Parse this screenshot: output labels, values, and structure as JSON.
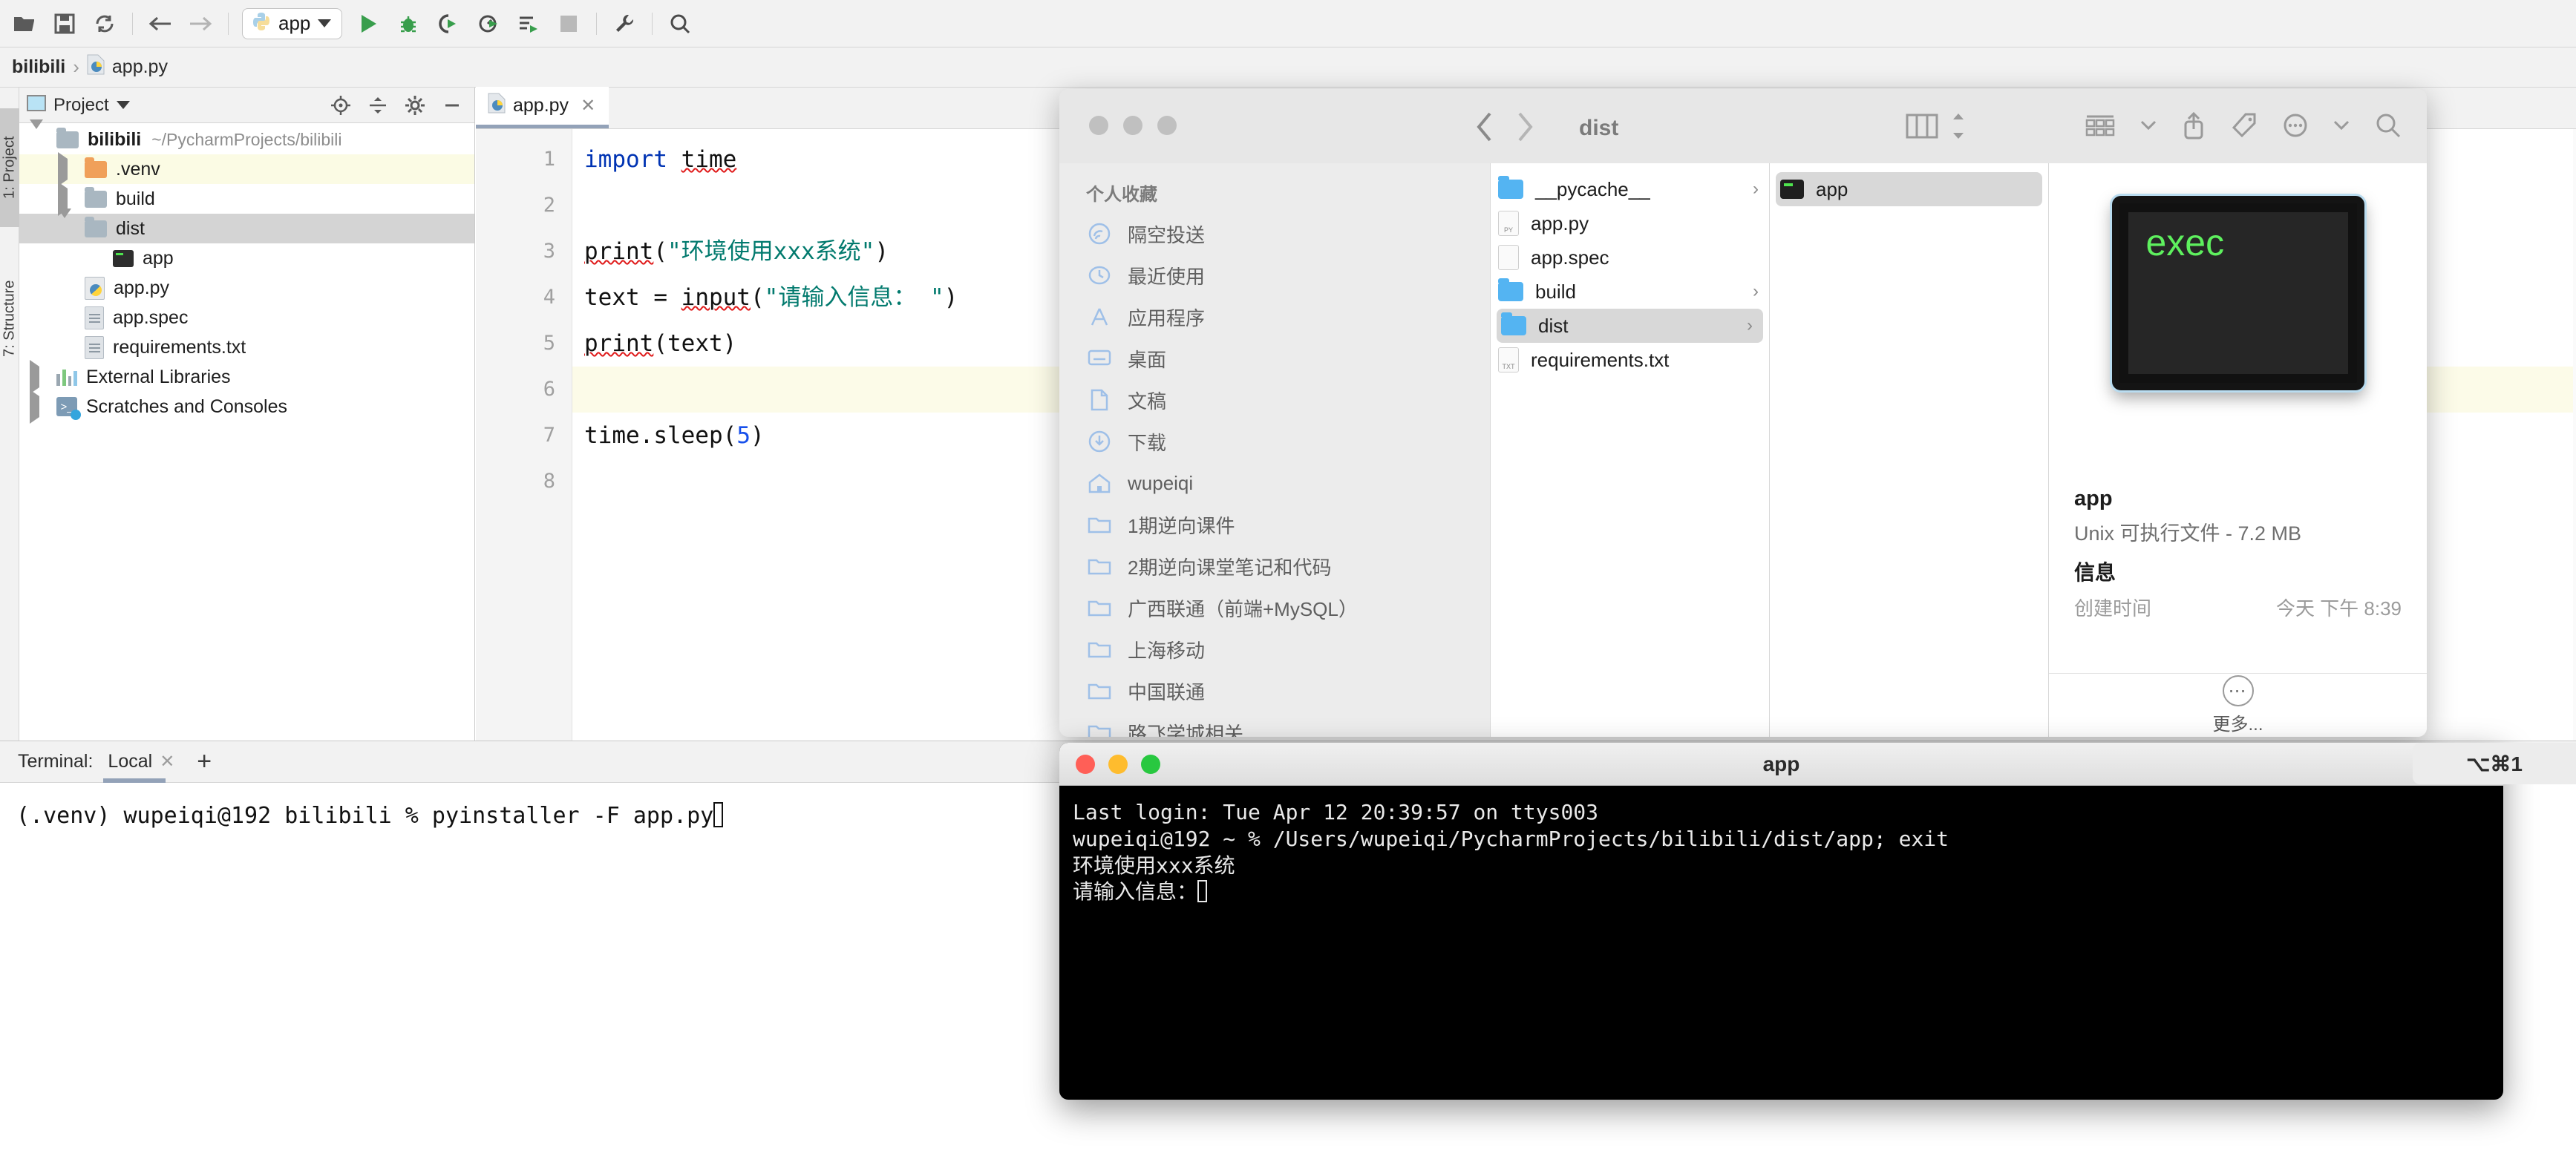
{
  "ide": {
    "toolbar": {
      "icons": [
        "open-folder-icon",
        "save-icon",
        "sync-icon",
        "back-arrow-icon",
        "forward-arrow-icon"
      ],
      "run_config": "app",
      "run_icons": [
        "run-icon",
        "debug-icon",
        "run-coverage-icon",
        "profile-icon",
        "run-with-icon",
        "stop-icon",
        "wrench-icon",
        "search-icon"
      ]
    },
    "breadcrumb": {
      "root": "bilibili",
      "sep": "›",
      "file": "app.py"
    },
    "left_tabs": [
      {
        "label": "1: Project"
      },
      {
        "label": "7: Structure"
      }
    ],
    "project_panel": {
      "title": "Project",
      "tree": [
        {
          "label": "bilibili",
          "path": "~/PycharmProjects/bilibili",
          "icon": "folder-icon",
          "twisty": "down",
          "bold": true,
          "indent": 0,
          "state": "none"
        },
        {
          "label": ".venv",
          "path": "",
          "icon": "folder-orange-icon",
          "twisty": "right",
          "bold": false,
          "indent": 1,
          "state": "yellow"
        },
        {
          "label": "build",
          "path": "",
          "icon": "folder-icon",
          "twisty": "right",
          "bold": false,
          "indent": 1,
          "state": "none"
        },
        {
          "label": "dist",
          "path": "",
          "icon": "folder-icon",
          "twisty": "down",
          "bold": false,
          "indent": 1,
          "state": "grey"
        },
        {
          "label": "app",
          "path": "",
          "icon": "exec-file-icon",
          "twisty": "none",
          "bold": false,
          "indent": 2,
          "state": "none"
        },
        {
          "label": "app.py",
          "path": "",
          "icon": "python-file-icon",
          "twisty": "none",
          "bold": false,
          "indent": 1,
          "state": "none"
        },
        {
          "label": "app.spec",
          "path": "",
          "icon": "text-file-icon",
          "twisty": "none",
          "bold": false,
          "indent": 1,
          "state": "none"
        },
        {
          "label": "requirements.txt",
          "path": "",
          "icon": "text-file-icon",
          "twisty": "none",
          "bold": false,
          "indent": 1,
          "state": "none"
        },
        {
          "label": "External Libraries",
          "path": "",
          "icon": "libraries-icon",
          "twisty": "right",
          "bold": false,
          "indent": 0,
          "state": "none"
        },
        {
          "label": "Scratches and Consoles",
          "path": "",
          "icon": "scratches-icon",
          "twisty": "right",
          "bold": false,
          "indent": 0,
          "state": "none"
        }
      ]
    },
    "editor": {
      "tab": {
        "label": "app.py",
        "close": "✕",
        "icon": "python-file-icon"
      },
      "line_numbers": [
        "1",
        "2",
        "3",
        "4",
        "5",
        "6",
        "7",
        "8"
      ],
      "lines": [
        {
          "n": "1",
          "segs": [
            {
              "t": "import",
              "c": "kw"
            },
            {
              "t": " ",
              "c": ""
            },
            {
              "t": "time",
              "c": "sq"
            }
          ],
          "hl": false
        },
        {
          "n": "2",
          "segs": [],
          "hl": false
        },
        {
          "n": "3",
          "segs": [
            {
              "t": "print",
              "c": "sq"
            },
            {
              "t": "(",
              "c": ""
            },
            {
              "t": "\"环境使用xxx系统\"",
              "c": "str"
            },
            {
              "t": ")",
              "c": ""
            }
          ],
          "hl": false
        },
        {
          "n": "4",
          "segs": [
            {
              "t": "text = ",
              "c": ""
            },
            {
              "t": "input",
              "c": "sq"
            },
            {
              "t": "(",
              "c": ""
            },
            {
              "t": "\"请输入信息： \"",
              "c": "str"
            },
            {
              "t": ")",
              "c": ""
            }
          ],
          "hl": false
        },
        {
          "n": "5",
          "segs": [
            {
              "t": "print",
              "c": "sq"
            },
            {
              "t": "(text)",
              "c": ""
            }
          ],
          "hl": false
        },
        {
          "n": "6",
          "segs": [],
          "hl": true
        },
        {
          "n": "7",
          "segs": [
            {
              "t": "time.sleep(",
              "c": ""
            },
            {
              "t": "5",
              "c": "num"
            },
            {
              "t": ")",
              "c": ""
            }
          ],
          "hl": false
        },
        {
          "n": "8",
          "segs": [],
          "hl": false
        }
      ]
    },
    "terminal_panel": {
      "label": "Terminal:",
      "tab": "Local",
      "tab_close": "✕",
      "add": "+",
      "command": "(.venv) wupeiqi@192 bilibili % pyinstaller  -F  app.py"
    }
  },
  "finder": {
    "title": "dist",
    "nav": {
      "back": "‹",
      "forward": "›"
    },
    "toolbar_icons": [
      "column-view-icon",
      "sort-arrows-icon",
      "group-view-icon",
      "chevron-down-icon",
      "share-icon",
      "tag-icon",
      "more-circle-icon",
      "chevron-down-icon",
      "search-icon"
    ],
    "sidebar": {
      "section": "个人收藏",
      "items": [
        {
          "label": "隔空投送",
          "icon": "airdrop-icon"
        },
        {
          "label": "最近使用",
          "icon": "clock-icon"
        },
        {
          "label": "应用程序",
          "icon": "applications-icon"
        },
        {
          "label": "桌面",
          "icon": "desktop-icon"
        },
        {
          "label": "文稿",
          "icon": "documents-icon"
        },
        {
          "label": "下载",
          "icon": "downloads-icon"
        },
        {
          "label": "wupeiqi",
          "icon": "home-icon"
        },
        {
          "label": "1期逆向课件",
          "icon": "folder-icon"
        },
        {
          "label": "2期逆向课堂笔记和代码",
          "icon": "folder-icon"
        },
        {
          "label": "广西联通（前端+MySQL）",
          "icon": "folder-icon"
        },
        {
          "label": "上海移动",
          "icon": "folder-icon"
        },
        {
          "label": "中国联通",
          "icon": "folder-icon"
        },
        {
          "label": "路飞学城相关",
          "icon": "folder-icon"
        }
      ]
    },
    "column1": [
      {
        "label": "__pycache__",
        "icon": "folder-icon",
        "chevron": "›",
        "selected": false
      },
      {
        "label": "app.py",
        "icon": "python-doc-icon",
        "chevron": "",
        "selected": false
      },
      {
        "label": "app.spec",
        "icon": "doc-icon",
        "chevron": "",
        "selected": false
      },
      {
        "label": "build",
        "icon": "folder-icon",
        "chevron": "›",
        "selected": false
      },
      {
        "label": "dist",
        "icon": "folder-icon",
        "chevron": "›",
        "selected": true
      },
      {
        "label": "requirements.txt",
        "icon": "txt-doc-icon",
        "chevron": "",
        "selected": false
      }
    ],
    "column2": [
      {
        "label": "app",
        "icon": "exec-file-icon",
        "chevron": "",
        "selected": true
      }
    ],
    "preview": {
      "thumb_text": "exec",
      "name": "app",
      "kind_size": "Unix 可执行文件 - 7.2 MB",
      "info_header": "信息",
      "info_key": "创建时间",
      "info_value": "今天 下午 8:39",
      "more_label": "更多...",
      "more_icon": "more-circle-icon"
    }
  },
  "mac_terminal": {
    "title": "app",
    "lines": [
      "Last login: Tue Apr 12 20:39:57 on ttys003",
      "wupeiqi@192 ~ % /Users/wupeiqi/PycharmProjects/bilibili/dist/app; exit",
      "环境使用xxx系统",
      "请输入信息："
    ]
  },
  "shortcut_badge": "⌥⌘1"
}
